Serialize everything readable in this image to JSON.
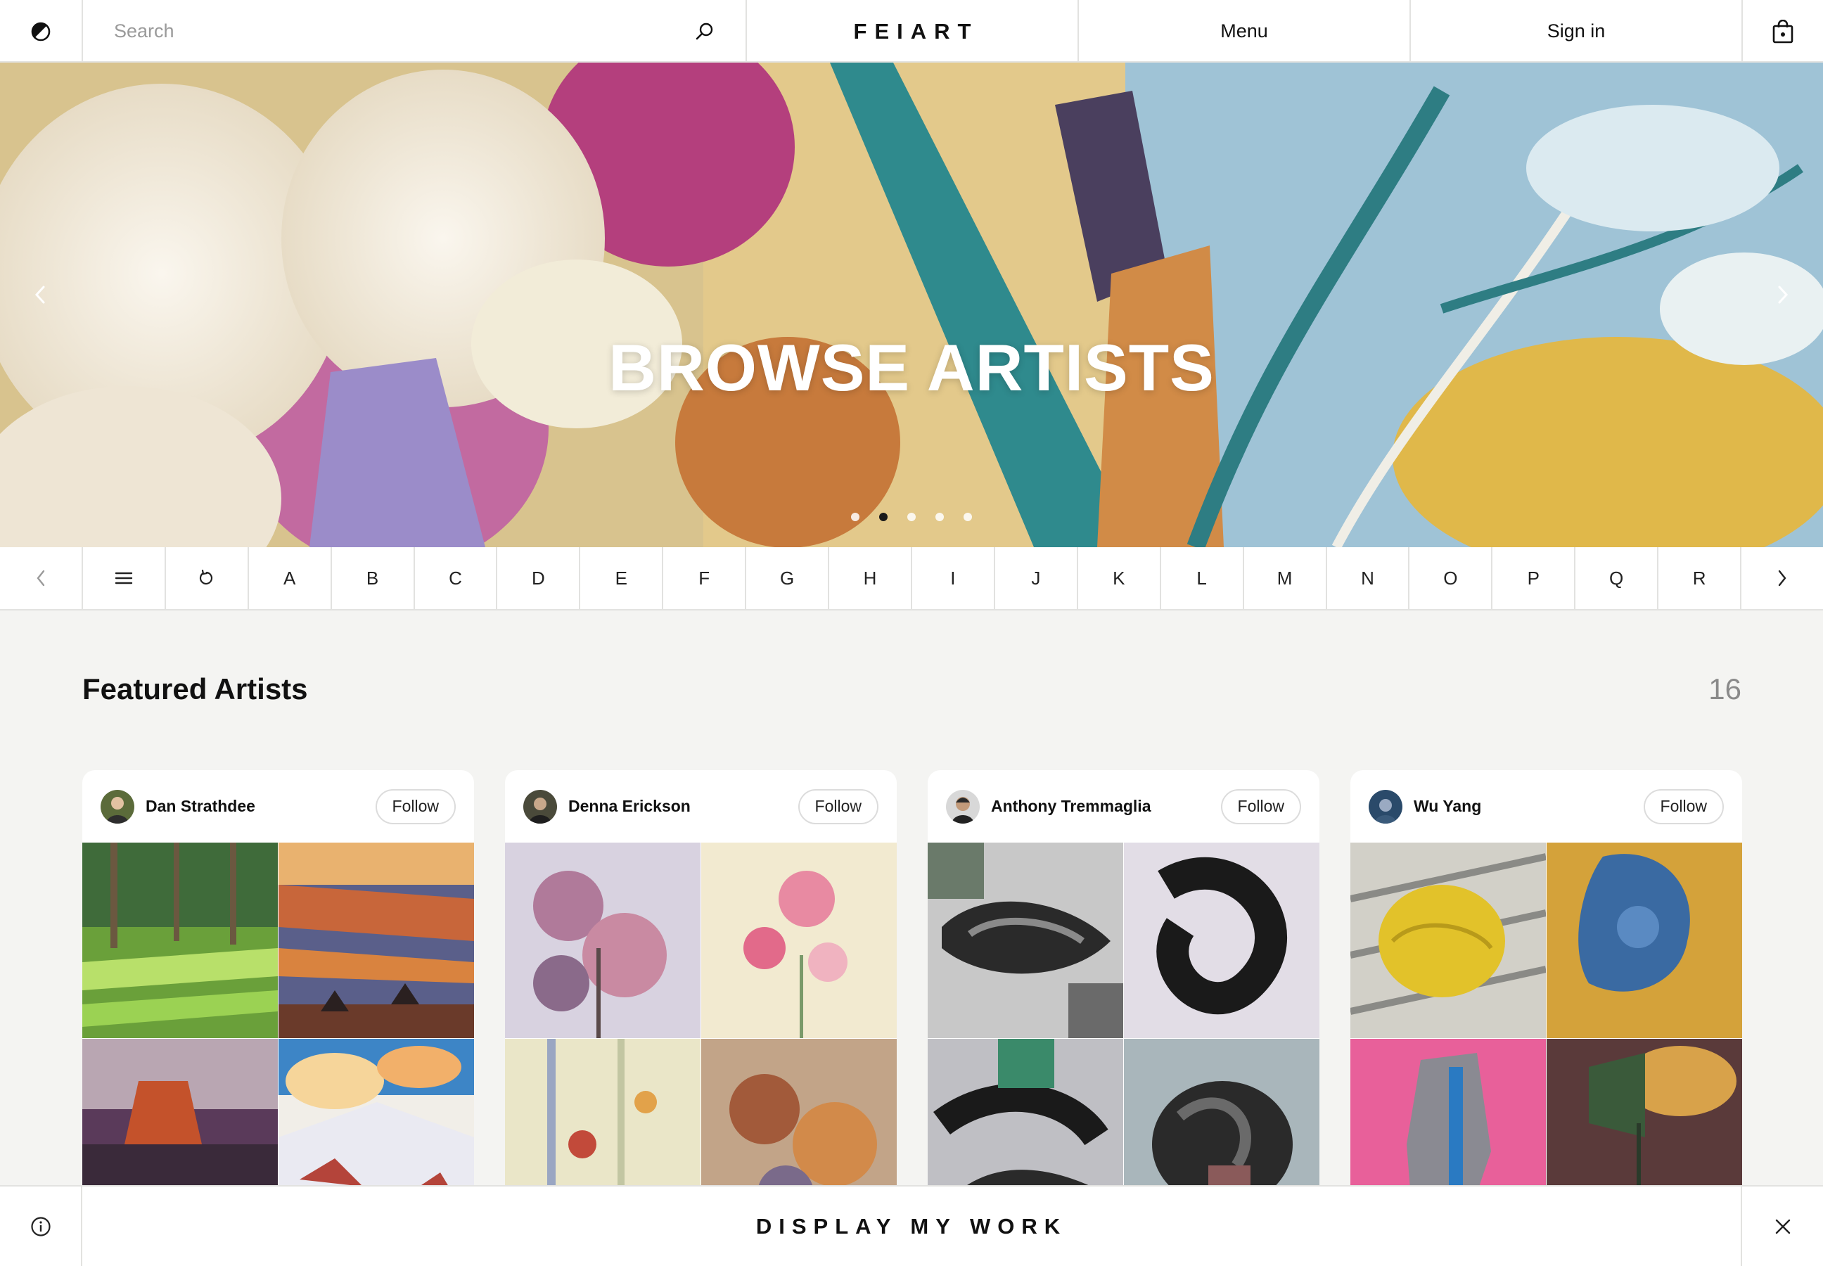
{
  "header": {
    "search_placeholder": "Search",
    "logo": "FEIART",
    "menu_label": "Menu",
    "signin_label": "Sign in",
    "icons": {
      "theme": "contrast-icon",
      "search": "search-icon",
      "bag": "shopping-bag-icon"
    }
  },
  "hero": {
    "title": "BROWSE ARTISTS",
    "slide_count": 5,
    "active_slide": 2
  },
  "alphabet": {
    "items": [
      "A",
      "B",
      "C",
      "D",
      "E",
      "F",
      "G",
      "H",
      "I",
      "J",
      "K",
      "L",
      "M",
      "N",
      "O",
      "P",
      "Q",
      "R"
    ],
    "icons": {
      "prev": "chevron-left-icon",
      "list": "list-icon",
      "reset": "refresh-icon",
      "next": "chevron-right-icon"
    }
  },
  "featured": {
    "title": "Featured Artists",
    "count": "16",
    "artists": [
      {
        "name": "Dan Strathdee",
        "follow_label": "Follow"
      },
      {
        "name": "Denna Erickson",
        "follow_label": "Follow"
      },
      {
        "name": "Anthony Tremmaglia",
        "follow_label": "Follow"
      },
      {
        "name": "Wu Yang",
        "follow_label": "Follow"
      }
    ]
  },
  "banner": {
    "cta": "DISPLAY MY WORK",
    "icons": {
      "info": "info-icon",
      "close": "close-icon"
    }
  },
  "colors": {
    "background": "#f4f4f2",
    "border": "#e2e2e0",
    "text": "#111111",
    "muted": "#8a8a8a"
  }
}
